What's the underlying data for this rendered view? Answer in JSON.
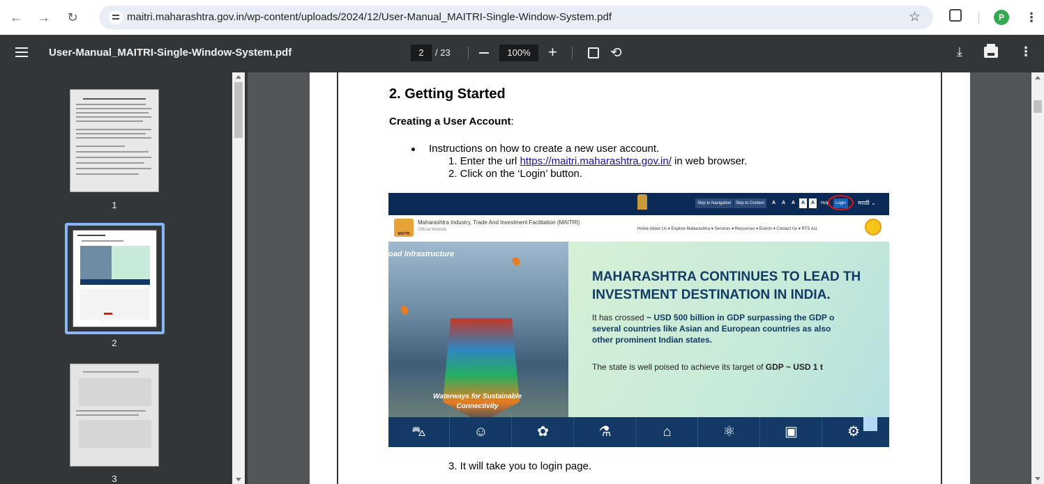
{
  "browser": {
    "url": "maitri.maharashtra.gov.in/wp-content/uploads/2024/12/User-Manual_MAITRI-Single-Window-System.pdf",
    "back_icon": "arrow-left-icon",
    "forward_icon": "arrow-right-icon",
    "reload_icon": "reload-icon",
    "profile_initial": "P",
    "profile_color": "#34a853"
  },
  "pdf_toolbar": {
    "title": "User-Manual_MAITRI-Single-Window-System.pdf",
    "current_page": "2",
    "total_pages": "/ 23",
    "zoom": "100%"
  },
  "sidebar": {
    "thumbnails": [
      {
        "label": "1"
      },
      {
        "label": "2",
        "selected": true
      },
      {
        "label": "3"
      }
    ],
    "selection_color": "#8ab4f8"
  },
  "document": {
    "heading": "2. Getting Started",
    "subheading": "Creating a User Account",
    "subheading_suffix": ":",
    "bullet": "Instructions on how to create a new user account.",
    "step1_prefix": "1.  Enter the url ",
    "step1_link": "https://maitri.maharashtra.gov.in/",
    "step1_suffix": " in web browser.",
    "step2": "2.  Click on the ‘Login’ button.",
    "step3": "3.  It will take you to login page."
  },
  "screenshot": {
    "topbar": {
      "skip_nav": "Skip to Navigation",
      "skip_content": "Skip to Content",
      "font_buttons": [
        "A",
        "A",
        "A",
        "A",
        "A"
      ],
      "help": "Help",
      "login": "Login",
      "language": "मराठी  ⌄"
    },
    "site_name": "Maharashtra Industry, Trade And Investment Facilitation (MAITRI)",
    "site_sub": "Official Website",
    "logo_text": "MAITRI",
    "nav": "Home   About Us ▾   Explore Maharashtra ▾   Services ▾   Resources ▾   Events ▾   Contact Us ▾   RTS Act",
    "banner_left_top": "oad Infrastructure",
    "banner_left_bottom_1": "Waterways for Sustainable",
    "banner_left_bottom_2": "Connectivity",
    "hero_line1": "MAHARASHTRA CONTINUES TO LEAD TH",
    "hero_line2": "INVESTMENT DESTINATION IN INDIA.",
    "hero_p1a": "It has crossed ",
    "hero_p1b": "~ USD 500 billion in GDP surpassing the GDP o",
    "hero_p1c": "several countries like Asian and European countries as also",
    "hero_p1d": "other prominent Indian states.",
    "hero_p2a": "The state is well poised to achieve its target of ",
    "hero_p2b": "GDP ~ USD 1 t",
    "sector_icons": [
      "car-icon",
      "worker-icon",
      "textile-icon",
      "flask-icon",
      "factory-icon",
      "network-icon",
      "monitor-icon",
      "spool-icon"
    ],
    "hero_color": "#123a63",
    "login_highlight_color": "#e01818"
  }
}
